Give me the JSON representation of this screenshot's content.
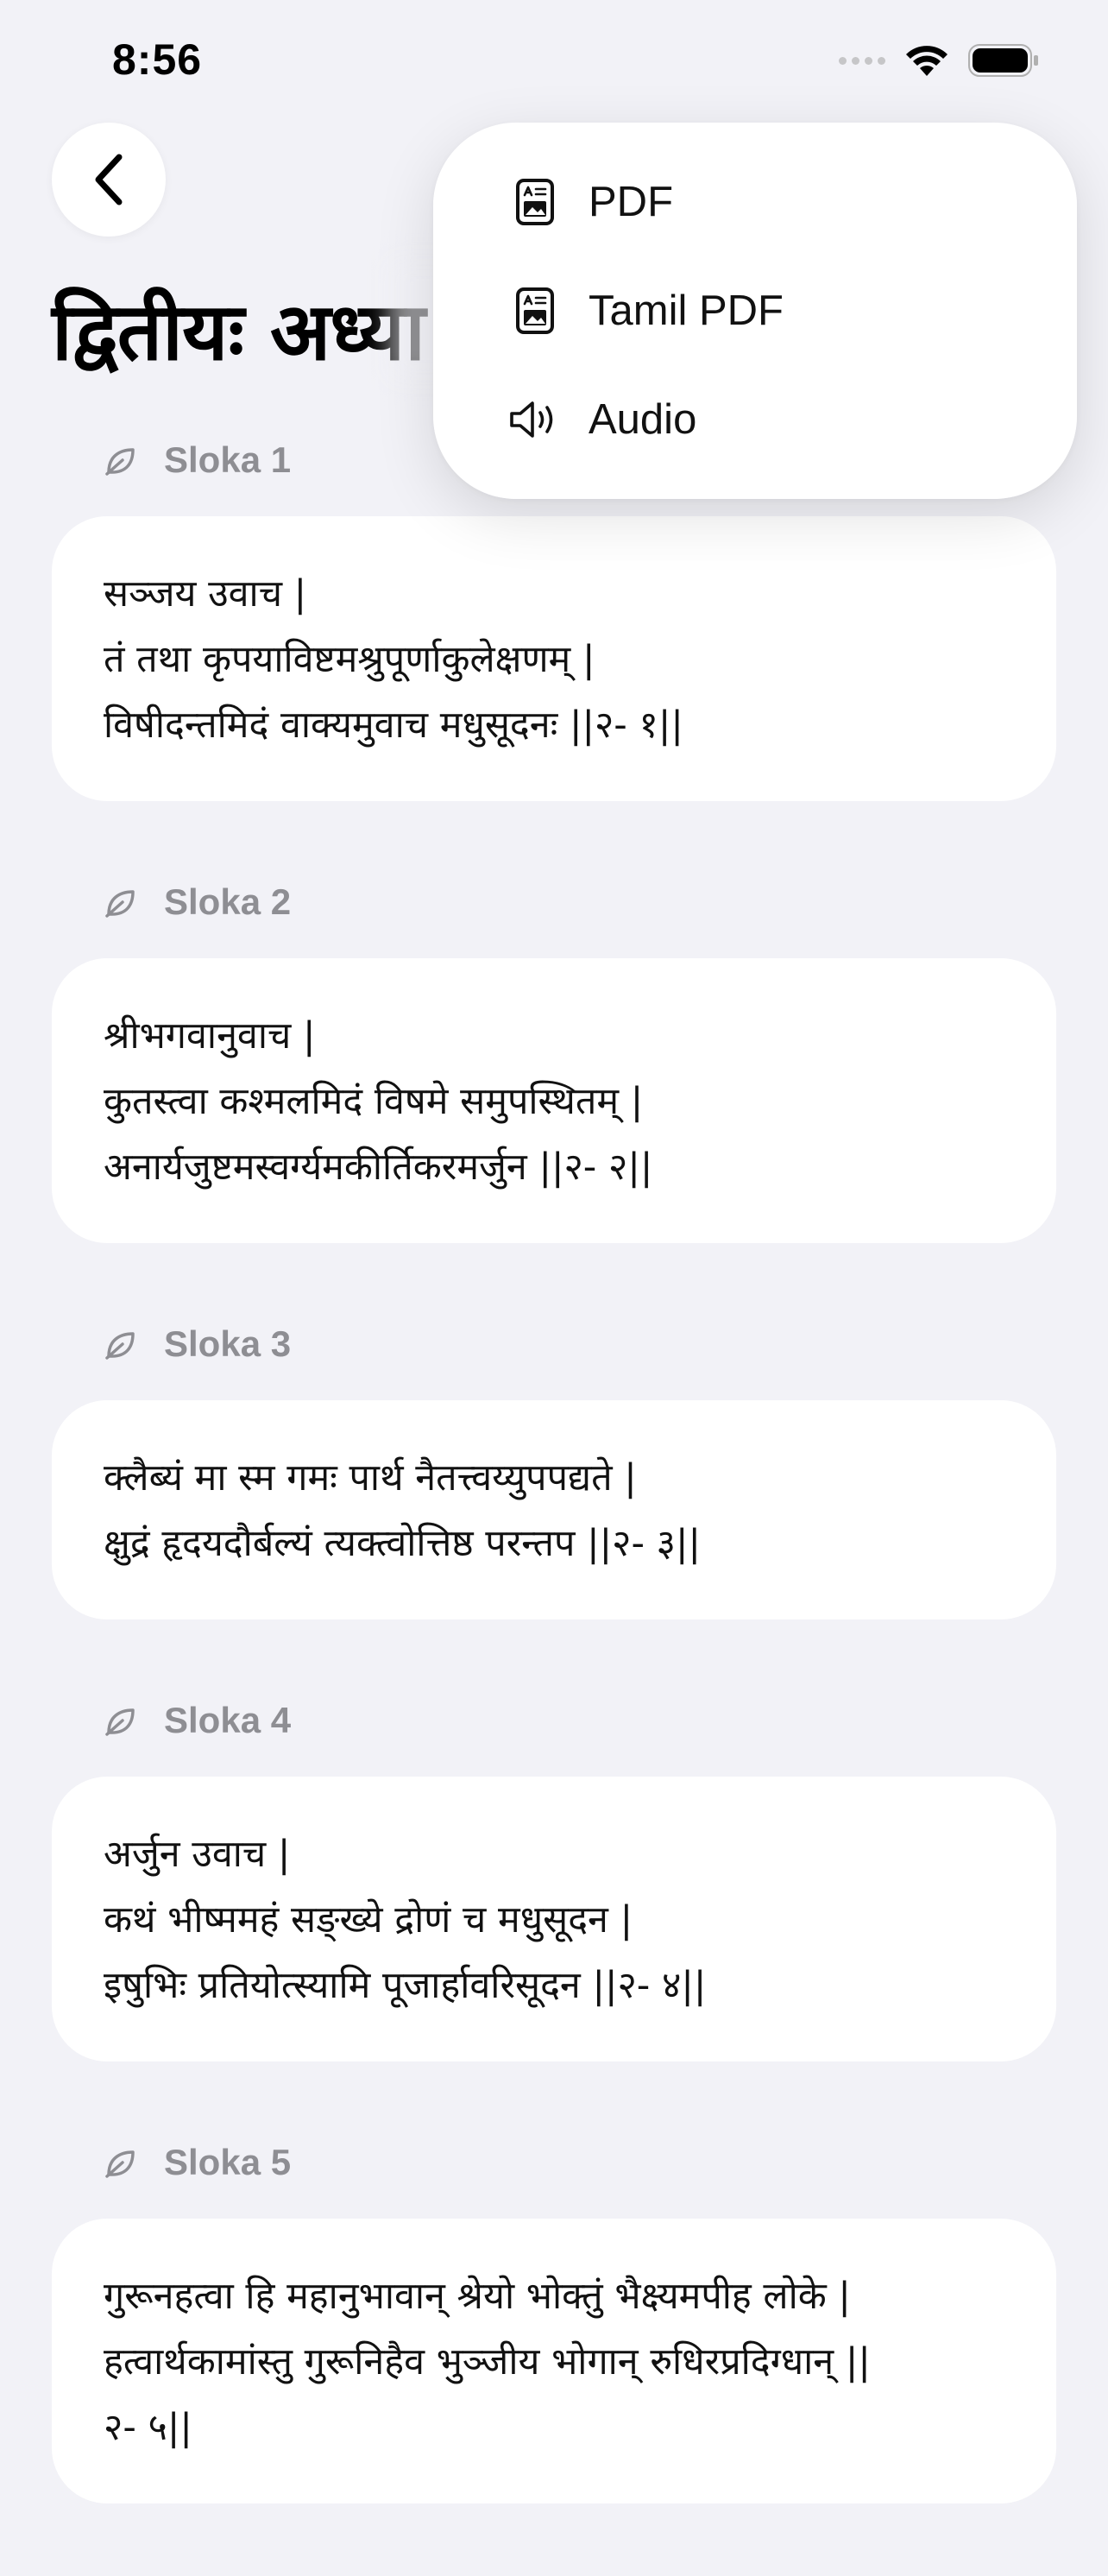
{
  "status": {
    "time": "8:56"
  },
  "page": {
    "title": "द्वितीयः अध्या"
  },
  "menu": {
    "items": [
      {
        "label": "PDF",
        "icon": "document-icon"
      },
      {
        "label": "Tamil PDF",
        "icon": "document-icon"
      },
      {
        "label": "Audio",
        "icon": "speaker-icon"
      }
    ]
  },
  "slokas": [
    {
      "label": "Sloka 1",
      "lines": [
        "सञ्जय उवाच |",
        "तं तथा कृपयाविष्टमश्रुपूर्णाकुलेक्षणम् |",
        "विषीदन्तमिदं वाक्यमुवाच मधुसूदनः ||२- १||"
      ]
    },
    {
      "label": "Sloka 2",
      "lines": [
        "श्रीभगवानुवाच |",
        "कुतस्त्वा कश्मलमिदं विषमे समुपस्थितम् |",
        "अनार्यजुष्टमस्वर्ग्यमकीर्तिकरमर्जुन ||२- २||"
      ]
    },
    {
      "label": "Sloka 3",
      "lines": [
        "क्लैब्यं मा स्म गमः पार्थ नैतत्त्वय्युपपद्यते |",
        "क्षुद्रं हृदयदौर्बल्यं त्यक्त्वोत्तिष्ठ परन्तप ||२- ३||"
      ]
    },
    {
      "label": "Sloka 4",
      "lines": [
        "अर्जुन उवाच |",
        "कथं भीष्ममहं सङ्ख्ये द्रोणं च मधुसूदन |",
        "इषुभिः प्रतियोत्स्यामि पूजार्हावरिसूदन ||२- ४||"
      ]
    },
    {
      "label": "Sloka 5",
      "lines": [
        "गुरूनहत्वा हि महानुभावान् श्रेयो भोक्तुं भैक्ष्यमपीह लोके |",
        "हत्वार्थकामांस्तु गुरूनिहैव भुञ्जीय भोगान् रुधिरप्रदिग्धान् ||",
        "२- ५||"
      ]
    }
  ]
}
